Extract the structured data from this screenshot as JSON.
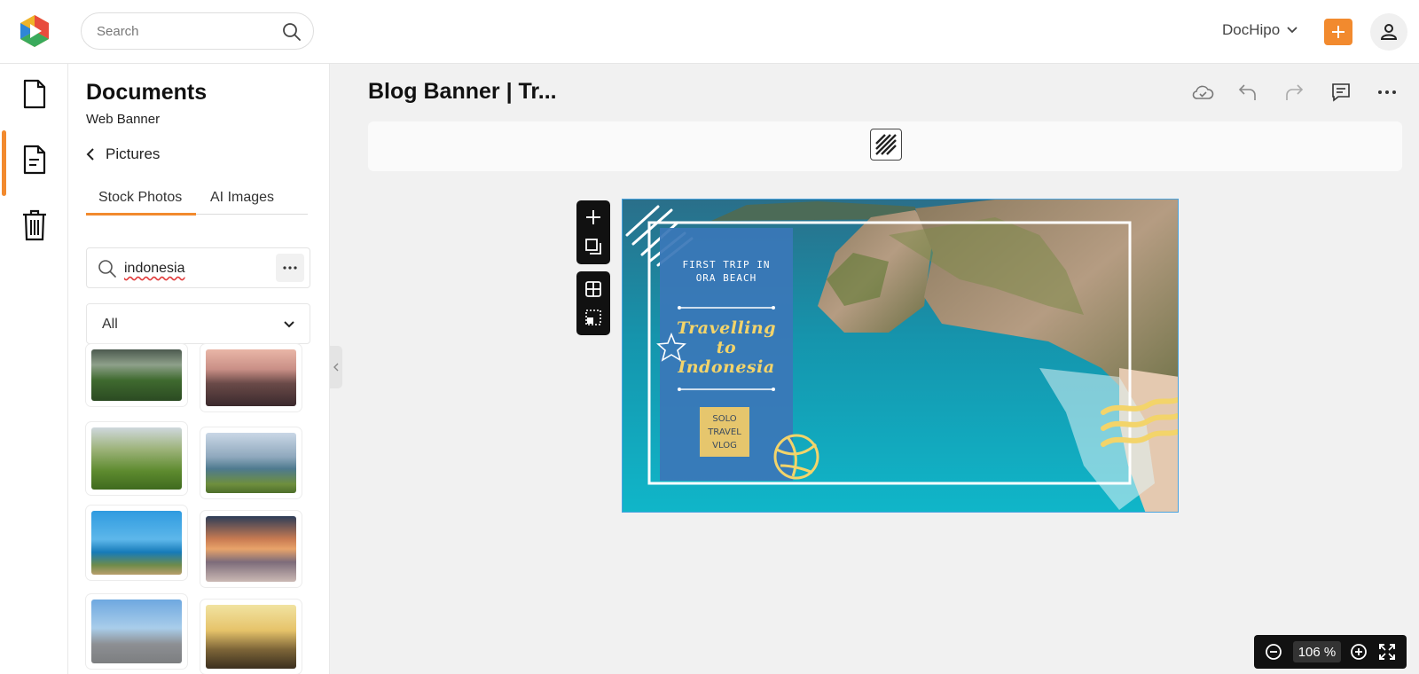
{
  "topbar": {
    "search_placeholder": "Search",
    "org_name": "DocHipo",
    "accent": "#f28a2e"
  },
  "rail": {
    "items": [
      "document-icon",
      "template-doc-icon",
      "trash-icon"
    ],
    "active_index": 1
  },
  "panel": {
    "title": "Documents",
    "subtitle": "Web Banner",
    "back_label": "Pictures",
    "tabs": [
      "Stock Photos",
      "AI Images"
    ],
    "active_tab": "Stock Photos",
    "image_search_value": "indonesia",
    "filter_value": "All",
    "thumbnails": [
      "rice-terrace-mist",
      "bromo-dusk",
      "green-rice-terraces",
      "lake-with-hills",
      "flag-on-cliff",
      "mountain-sunset-clouds",
      "prambanan-temple",
      "borobudur-stupas"
    ]
  },
  "editor": {
    "doc_title": "Blog Banner | Tr...",
    "top_actions": [
      "cloud-save-icon",
      "undo-icon",
      "redo-icon",
      "comments-icon",
      "more-icon"
    ],
    "zoom_level": "106 %"
  },
  "banner": {
    "kicker": "FIRST TRIP IN\nORA BEACH",
    "headline": "Travelling\nto\nIndonesia",
    "badge": "SOLO\nTRAVEL\nVLOG",
    "colors": {
      "panel_blue": "#3a77b8",
      "yellow": "#f3d46a",
      "frame": "#ffffff"
    }
  }
}
